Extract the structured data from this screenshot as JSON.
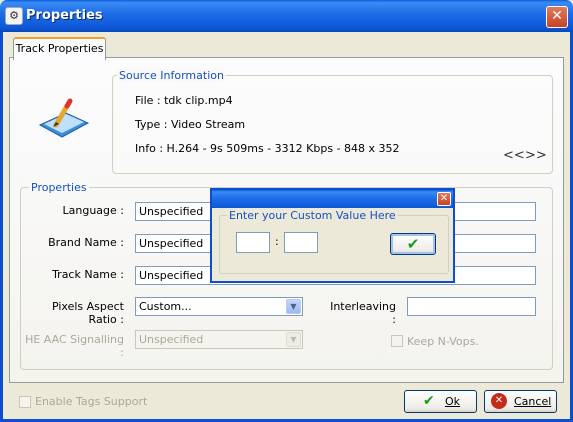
{
  "window": {
    "title": "Properties",
    "app_icon": "gear-icon",
    "close_icon": "close-icon"
  },
  "tabs": [
    {
      "label": "Track Properties"
    }
  ],
  "source": {
    "legend": "Source Information",
    "file": "File : tdk clip.mp4",
    "type": "Type : Video Stream",
    "info": "Info : H.264 - 9s 509ms - 3312 Kbps - 848 x 352",
    "prev_label": "<<",
    "next_label": ">>",
    "icon": "document-edit-icon"
  },
  "properties": {
    "legend": "Properties",
    "language_label": "Language :",
    "language_value": "Unspecified",
    "brand_label": "Brand Name :",
    "brand_value": "Unspecified",
    "track_label": "Track Name :",
    "track_value": "Unspecified",
    "par_label": "Pixels Aspect Ratio :",
    "par_value": "Custom...",
    "heaac_label": "HE AAC Signalling :",
    "heaac_value": "Unspecified",
    "interleaving_label": "Interleaving :",
    "interleaving_value": "",
    "keep_nvops_label": "Keep N-Vops."
  },
  "footer": {
    "enable_tags_label": "Enable Tags Support",
    "ok_label": "Ok",
    "cancel_label": "Cancel"
  },
  "custom_dialog": {
    "legend": "Enter your Custom Value Here",
    "value_a": "",
    "value_b": "",
    "separator": ":",
    "ok_icon": "checkmark-icon"
  },
  "colors": {
    "title_blue": "#0d56d6",
    "legend_blue": "#1550c8",
    "ok_green": "#1a9a1a",
    "cancel_red": "#c62a1a"
  }
}
